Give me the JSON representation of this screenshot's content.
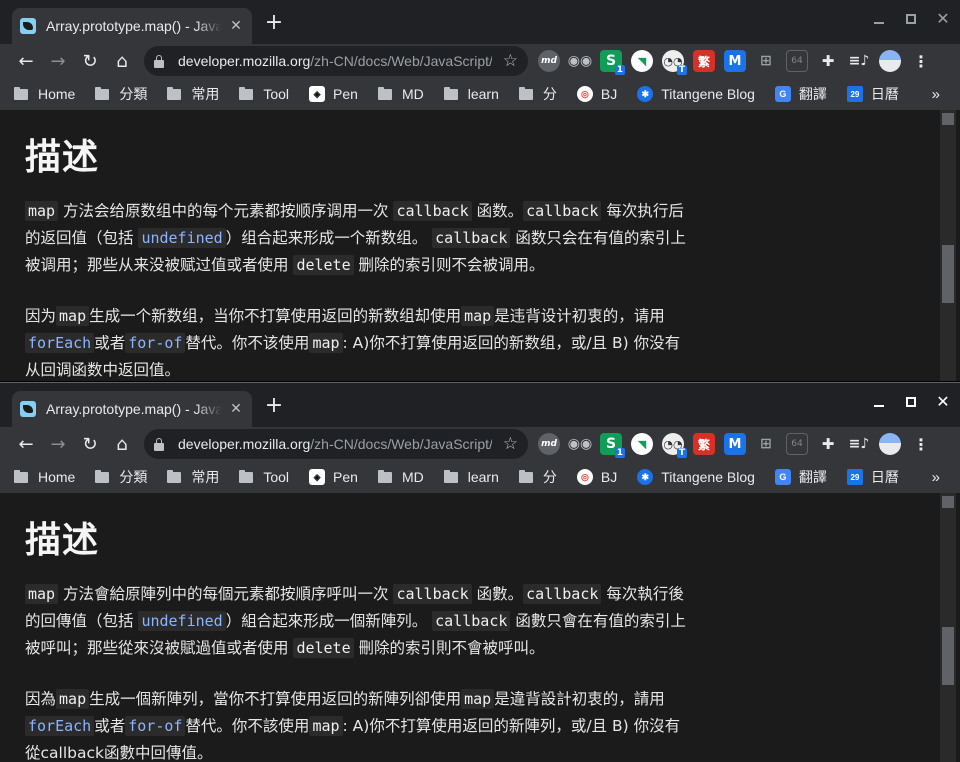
{
  "windows": [
    {
      "tab": {
        "title": "Array.prototype.map() - JavaScript | MDN",
        "close": "✕"
      },
      "toolbar": {
        "url_host": "developer.mozilla.org",
        "url_path": "/zh-CN/docs/Web/JavaScript/Reference/Global_Objects/Array/map"
      },
      "heading": "描述",
      "para1": [
        {
          "t": "code",
          "v": "map"
        },
        {
          "t": "text",
          "v": " 方法会给原数组中的每个元素都按顺序调用一次 "
        },
        {
          "t": "code",
          "v": "callback"
        },
        {
          "t": "text",
          "v": " 函数。"
        },
        {
          "t": "code",
          "v": "callback"
        },
        {
          "t": "text",
          "v": " 每次执行后的返回值（包括 "
        },
        {
          "t": "link",
          "v": "undefined"
        },
        {
          "t": "text",
          "v": "）组合起来形成一个新数组。 "
        },
        {
          "t": "code",
          "v": "callback"
        },
        {
          "t": "text",
          "v": " 函数只会在有值的索引上被调用；那些从来没被赋过值或者使用 "
        },
        {
          "t": "code",
          "v": "delete"
        },
        {
          "t": "text",
          "v": " 删除的索引则不会被调用。"
        }
      ],
      "para2": [
        {
          "t": "text",
          "v": "因为"
        },
        {
          "t": "code",
          "v": "map"
        },
        {
          "t": "text",
          "v": "生成一个新数组，当你不打算使用返回的新数组却使用"
        },
        {
          "t": "code",
          "v": "map"
        },
        {
          "t": "text",
          "v": "是违背设计初衷的，请用"
        },
        {
          "t": "link",
          "v": "forEach"
        },
        {
          "t": "text",
          "v": "或者"
        },
        {
          "t": "link",
          "v": "for-of"
        },
        {
          "t": "text",
          "v": "替代。你不该使用"
        },
        {
          "t": "code",
          "v": "map"
        },
        {
          "t": "text",
          "v": ": A)你不打算使用返回的新数组，或/且 B) 你没有从回调函数中返回值。"
        }
      ]
    },
    {
      "tab": {
        "title": "Array.prototype.map() - JavaScript | MDN",
        "close": "✕"
      },
      "toolbar": {
        "url_host": "developer.mozilla.org",
        "url_path": "/zh-CN/docs/Web/JavaScript/Reference/Global_Objects/Array/map"
      },
      "heading": "描述",
      "para1": [
        {
          "t": "code",
          "v": "map"
        },
        {
          "t": "text",
          "v": " 方法會給原陣列中的每個元素都按順序呼叫一次 "
        },
        {
          "t": "code",
          "v": "callback"
        },
        {
          "t": "text",
          "v": " 函數。"
        },
        {
          "t": "code",
          "v": "callback"
        },
        {
          "t": "text",
          "v": " 每次執行後的回傳值（包括 "
        },
        {
          "t": "link",
          "v": "undefined"
        },
        {
          "t": "text",
          "v": "）組合起來形成一個新陣列。 "
        },
        {
          "t": "code",
          "v": "callback"
        },
        {
          "t": "text",
          "v": " 函數只會在有值的索引上被呼叫；那些從來沒被賦過值或者使用 "
        },
        {
          "t": "code",
          "v": "delete"
        },
        {
          "t": "text",
          "v": " 刪除的索引則不會被呼叫。"
        }
      ],
      "para2": [
        {
          "t": "text",
          "v": "因為"
        },
        {
          "t": "code",
          "v": "map"
        },
        {
          "t": "text",
          "v": "生成一個新陣列，當你不打算使用返回的新陣列卻使用"
        },
        {
          "t": "code",
          "v": "map"
        },
        {
          "t": "text",
          "v": "是違背設計初衷的，請用"
        },
        {
          "t": "link",
          "v": "forEach"
        },
        {
          "t": "text",
          "v": "或者"
        },
        {
          "t": "link",
          "v": "for-of"
        },
        {
          "t": "text",
          "v": "替代。你不該使用"
        },
        {
          "t": "code",
          "v": "map"
        },
        {
          "t": "text",
          "v": ": A)你不打算使用返回的新陣列，或/且 B) 你沒有從callback函數中回傳值。"
        }
      ]
    }
  ],
  "new_tab": "+",
  "extensions": [
    {
      "name": "md",
      "label": "md",
      "cls": "ext-md"
    },
    {
      "name": "owl",
      "label": "◉◉",
      "cls": "ext-owl"
    },
    {
      "name": "s",
      "label": "S",
      "cls": "ext-s",
      "badge": "1"
    },
    {
      "name": "circle",
      "label": "◥",
      "cls": "ext-circ"
    },
    {
      "name": "glasses",
      "label": "◔◔",
      "cls": "ext-glasses",
      "badge": "T"
    },
    {
      "name": "traditional",
      "label": "繁",
      "cls": "ext-trad"
    },
    {
      "name": "m",
      "label": "M",
      "cls": "ext-m"
    },
    {
      "name": "tree",
      "label": "⊞",
      "cls": "ext-tree"
    },
    {
      "name": "64",
      "label": "64",
      "cls": "ext-64"
    },
    {
      "name": "puzzle",
      "label": "✚",
      "cls": "ext-puzzle"
    },
    {
      "name": "media",
      "label": "≡♪",
      "cls": "ext-media"
    },
    {
      "name": "avatar",
      "label": "",
      "cls": "ext-avatar"
    },
    {
      "name": "menu",
      "label": "⋮",
      "cls": "ext-menu"
    }
  ],
  "bookmarks": [
    {
      "label": "Home",
      "icon": "folder"
    },
    {
      "label": "分類",
      "icon": "folder"
    },
    {
      "label": "常用",
      "icon": "folder"
    },
    {
      "label": "Tool",
      "icon": "folder"
    },
    {
      "label": "Pen",
      "icon": "pen",
      "glyph": "◈"
    },
    {
      "label": "MD",
      "icon": "folder"
    },
    {
      "label": "learn",
      "icon": "folder"
    },
    {
      "label": "分",
      "icon": "folder"
    },
    {
      "label": "BJ",
      "icon": "bj",
      "glyph": "◎"
    },
    {
      "label": "Titangene Blog",
      "icon": "tita",
      "glyph": "✱"
    },
    {
      "label": "翻譯",
      "icon": "trans",
      "glyph": "G"
    },
    {
      "label": "日曆",
      "icon": "cal",
      "glyph": "29"
    }
  ],
  "bookmarks_more": "»",
  "scroll": {
    "top_window_position": 0.52,
    "bottom_window_position": 0.52
  }
}
